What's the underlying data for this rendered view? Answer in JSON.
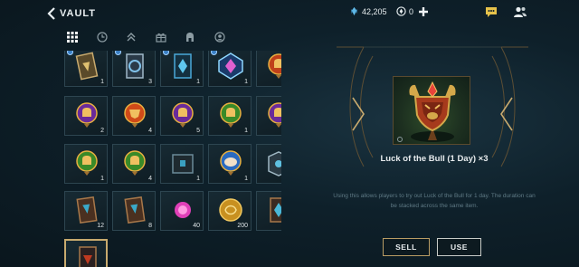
{
  "header": {
    "title": "VAULT",
    "currency_primary": "42,205",
    "currency_secondary": "0"
  },
  "tabs": [
    {
      "icon": "grid-icon",
      "active": true
    },
    {
      "icon": "clock-icon",
      "active": false
    },
    {
      "icon": "chevrons-up-icon",
      "active": false
    },
    {
      "icon": "gift-icon",
      "active": false
    },
    {
      "icon": "helmet-icon",
      "active": false
    },
    {
      "icon": "emote-icon",
      "active": false
    }
  ],
  "grid": {
    "rows": [
      [
        {
          "name": "card-gold",
          "qty": "1",
          "badge": true
        },
        {
          "name": "card-silver",
          "qty": "3",
          "badge": true
        },
        {
          "name": "card-blue",
          "qty": "1",
          "badge": true
        },
        {
          "name": "card-prismatic",
          "qty": "1",
          "badge": true
        },
        {
          "name": "orb-red-helmet",
          "qty": "1",
          "badge": false
        }
      ],
      [
        {
          "name": "orb-purple-helmet",
          "qty": "2",
          "badge": false
        },
        {
          "name": "orb-red-bull",
          "qty": "4",
          "badge": false
        },
        {
          "name": "orb-purple-helmet",
          "qty": "5",
          "badge": false
        },
        {
          "name": "orb-green-helmet",
          "qty": "1",
          "badge": false
        },
        {
          "name": "orb-purple-helmet",
          "qty": "1",
          "badge": false
        }
      ],
      [
        {
          "name": "orb-green-helmet",
          "qty": "1",
          "badge": false
        },
        {
          "name": "orb-green-helmet",
          "qty": "4",
          "badge": false
        },
        {
          "name": "chest-dark",
          "qty": "1",
          "badge": false
        },
        {
          "name": "orb-blue-poro",
          "qty": "1",
          "badge": false
        },
        {
          "name": "chest-silver",
          "qty": "1",
          "badge": false
        }
      ],
      [
        {
          "name": "card-bronze",
          "qty": "12",
          "badge": false
        },
        {
          "name": "card-bronze",
          "qty": "8",
          "badge": false
        },
        {
          "name": "essence-pink",
          "qty": "40",
          "badge": false
        },
        {
          "name": "coin-gold",
          "qty": "200",
          "badge": false
        },
        {
          "name": "card-bronze-blue",
          "qty": "6",
          "badge": false
        }
      ],
      [
        {
          "name": "card-selected",
          "qty": "",
          "badge": false,
          "selected": true
        }
      ]
    ]
  },
  "detail": {
    "name": "Luck of the Bull (1 Day) ×3",
    "description_line1": "Using this allows players to try out Luck of the Bull for 1 day. The duration can",
    "description_line2": "be stacked across the same item.",
    "sell_label": "SELL",
    "use_label": "USE"
  },
  "colors": {
    "gold": "#c8aa6e",
    "background": "#0e202a",
    "text_dim": "#5f7a85"
  }
}
